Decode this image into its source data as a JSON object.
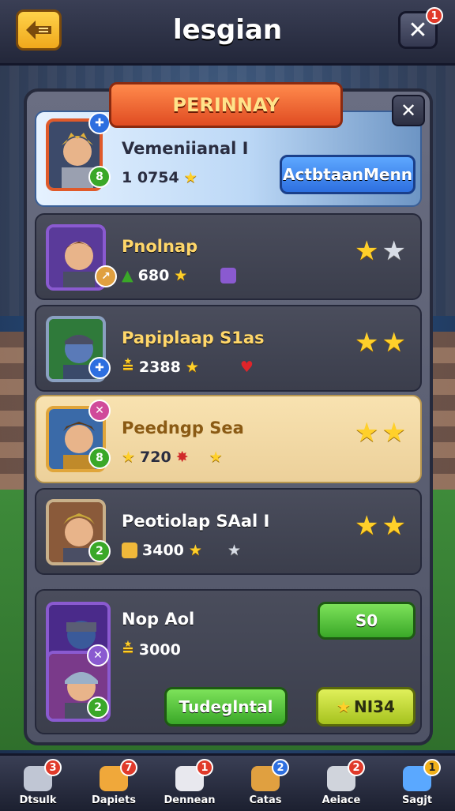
{
  "header": {
    "title": "lesgian",
    "close_badge": "1"
  },
  "panel": {
    "ribbon": "PERINNAY"
  },
  "rows": [
    {
      "name": "Vemeniianal I",
      "stat": "1 0754",
      "avatar_badge_top": "",
      "avatar_badge_bottom": "8",
      "button": "ActbtaanMenn"
    },
    {
      "name": "Pnolnap",
      "stat": "680",
      "avatar_badge_bottom": "",
      "stars": 2,
      "stars_filled": 1
    },
    {
      "name": "Papiplaap S1as",
      "stat": "2388",
      "stars": 2,
      "stars_filled": 2
    },
    {
      "name": "Peedngp Sea",
      "stat": "720",
      "avatar_badge_bottom": "8",
      "stars": 2,
      "stars_filled": 2
    },
    {
      "name": "Peotiolap SAal I",
      "stat": "3400",
      "avatar_badge_bottom": "2",
      "stars": 2,
      "stars_filled": 2
    },
    {
      "name": "Nop Aol",
      "stat": "3000",
      "avatar_badge_bottom": "2",
      "button_top": "S0",
      "button_left": "Tudeglntal",
      "button_right": "NI34"
    }
  ],
  "nav": [
    {
      "label": "Dtsulk",
      "badge": "3",
      "icon": "hammer-icon",
      "color": "#c0c6d4"
    },
    {
      "label": "Dapiets",
      "badge": "7",
      "icon": "house-icon",
      "color": "#f0a83a"
    },
    {
      "label": "Dennean",
      "badge": "1",
      "icon": "dice-icon",
      "color": "#e8e8ee"
    },
    {
      "label": "Catas",
      "badge": "2",
      "icon": "chest-icon",
      "color": "#e0a040"
    },
    {
      "label": "Aeiace",
      "badge": "2",
      "icon": "rock-icon",
      "color": "#d0d4dc"
    },
    {
      "label": "Sagjt",
      "badge": "1",
      "icon": "gem-icon",
      "color": "#5aa8ff"
    }
  ],
  "colors": {
    "accent": "#e04c22",
    "gold": "#ffd02a",
    "green": "#3aa828",
    "blue": "#2d6fe0"
  }
}
